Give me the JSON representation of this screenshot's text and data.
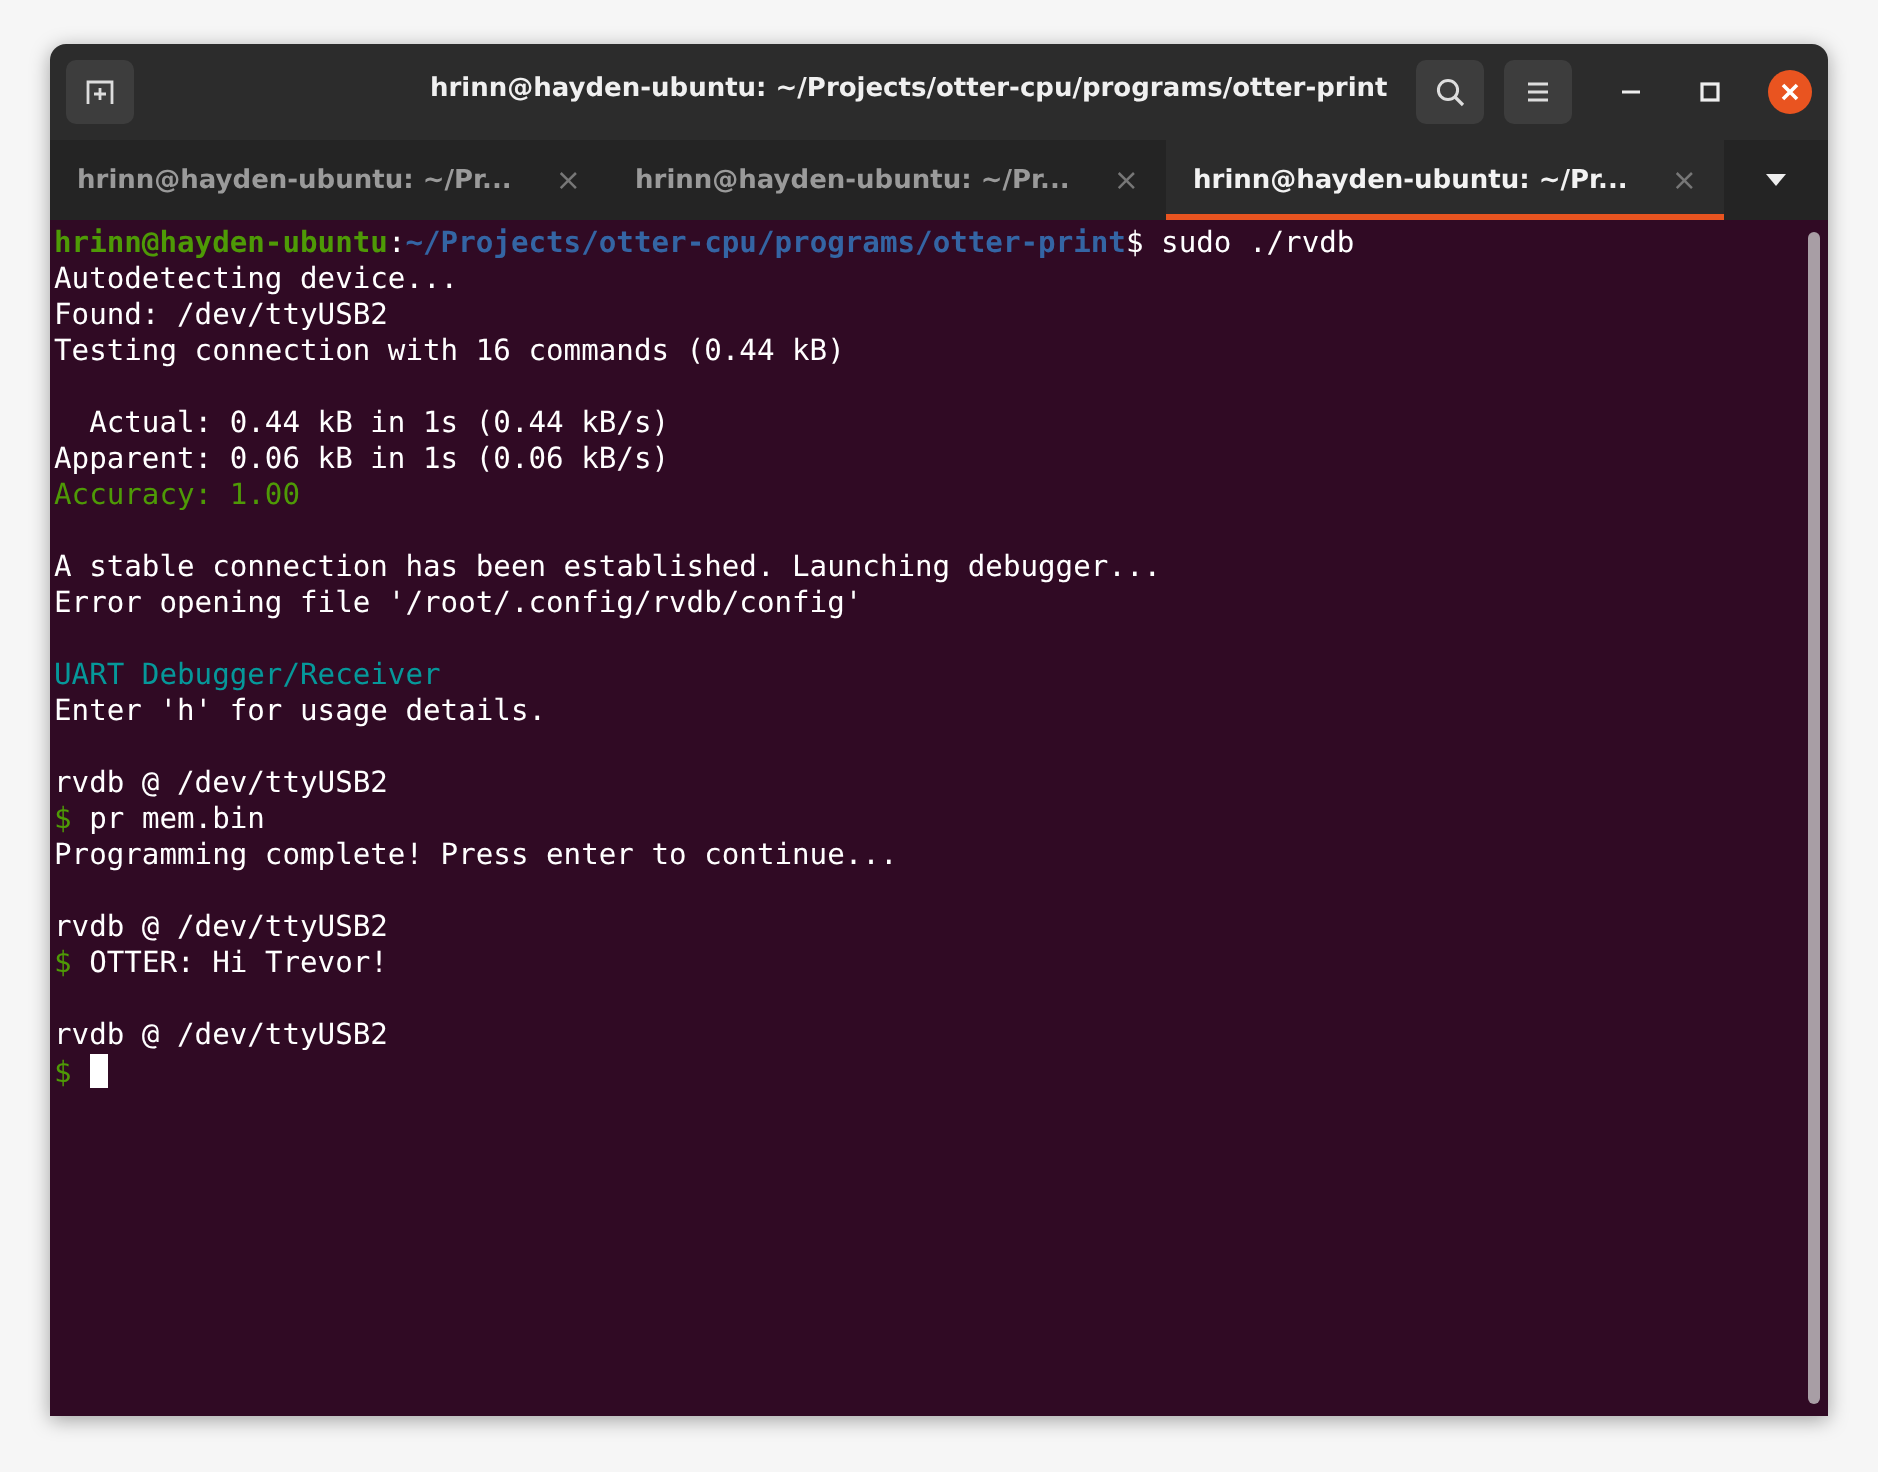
{
  "window": {
    "title": "hrinn@hayden-ubuntu: ~/Projects/otter-cpu/programs/otter-print"
  },
  "tabs": [
    {
      "label": "hrinn@hayden-ubuntu: ~/Pr...",
      "close": "×",
      "selected": false
    },
    {
      "label": "hrinn@hayden-ubuntu: ~/Pr...",
      "close": "×",
      "selected": false
    },
    {
      "label": "hrinn@hayden-ubuntu: ~/Pr...",
      "close": "×",
      "selected": true
    }
  ],
  "terminal": {
    "lines": [
      {
        "kind": "text",
        "segments": [
          {
            "kind": "user",
            "text": "hrinn@hayden-ubuntu"
          },
          {
            "kind": "plain",
            "text": ":"
          },
          {
            "kind": "path",
            "text": "~/Projects/otter-cpu/programs/otter-print"
          },
          {
            "kind": "plain",
            "text": "$ sudo ./rvdb"
          }
        ]
      },
      {
        "kind": "text",
        "segments": [
          {
            "kind": "plain",
            "text": "Autodetecting device..."
          }
        ]
      },
      {
        "kind": "text",
        "segments": [
          {
            "kind": "plain",
            "text": "Found: /dev/ttyUSB2"
          }
        ]
      },
      {
        "kind": "text",
        "segments": [
          {
            "kind": "plain",
            "text": "Testing connection with 16 commands (0.44 kB)"
          }
        ]
      },
      {
        "kind": "blank"
      },
      {
        "kind": "text",
        "segments": [
          {
            "kind": "plain",
            "text": "  Actual: 0.44 kB in 1s (0.44 kB/s)"
          }
        ]
      },
      {
        "kind": "text",
        "segments": [
          {
            "kind": "plain",
            "text": "Apparent: 0.06 kB in 1s (0.06 kB/s)"
          }
        ]
      },
      {
        "kind": "text",
        "segments": [
          {
            "kind": "success",
            "text": "Accuracy: 1.00"
          }
        ]
      },
      {
        "kind": "blank"
      },
      {
        "kind": "text",
        "segments": [
          {
            "kind": "plain",
            "text": "A stable connection has been established. Launching debugger..."
          }
        ]
      },
      {
        "kind": "text",
        "segments": [
          {
            "kind": "plain",
            "text": "Error opening file '/root/.config/rvdb/config'"
          }
        ]
      },
      {
        "kind": "blank"
      },
      {
        "kind": "text",
        "segments": [
          {
            "kind": "heading",
            "text": "UART Debugger/Receiver"
          }
        ]
      },
      {
        "kind": "text",
        "segments": [
          {
            "kind": "plain",
            "text": "Enter 'h' for usage details."
          }
        ]
      },
      {
        "kind": "blank"
      },
      {
        "kind": "text",
        "segments": [
          {
            "kind": "plain",
            "text": "rvdb @ /dev/ttyUSB2"
          }
        ]
      },
      {
        "kind": "text",
        "segments": [
          {
            "kind": "prompt",
            "text": "$"
          },
          {
            "kind": "plain",
            "text": " pr mem.bin"
          }
        ]
      },
      {
        "kind": "text",
        "segments": [
          {
            "kind": "plain",
            "text": "Programming complete! Press enter to continue..."
          }
        ]
      },
      {
        "kind": "blank"
      },
      {
        "kind": "text",
        "segments": [
          {
            "kind": "plain",
            "text": "rvdb @ /dev/ttyUSB2"
          }
        ]
      },
      {
        "kind": "text",
        "segments": [
          {
            "kind": "prompt",
            "text": "$"
          },
          {
            "kind": "plain",
            "text": " OTTER: Hi Trevor!"
          }
        ]
      },
      {
        "kind": "blank"
      },
      {
        "kind": "text",
        "segments": [
          {
            "kind": "plain",
            "text": "rvdb @ /dev/ttyUSB2"
          }
        ]
      },
      {
        "kind": "text",
        "cursor": true,
        "segments": [
          {
            "kind": "prompt",
            "text": "$"
          }
        ]
      }
    ]
  }
}
